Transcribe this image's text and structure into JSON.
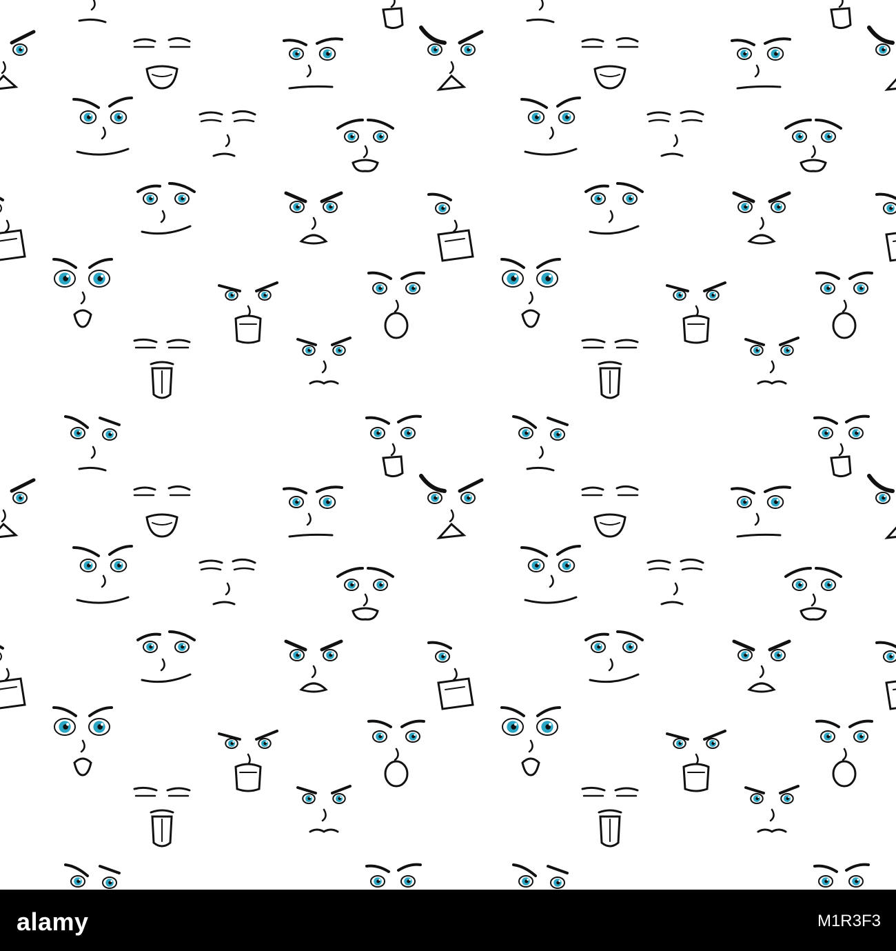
{
  "image": {
    "subject": "seamless-faces-pattern",
    "palette": {
      "background": "#ffffff",
      "ink": "#111111",
      "iris": "#2aa5c4",
      "footer": "#000000",
      "footer_text": "#ffffff"
    },
    "faces": [
      {
        "id": "worried",
        "expression": "worried"
      },
      {
        "id": "wink-smile",
        "expression": "wink-smile"
      },
      {
        "id": "side-eye",
        "expression": "side-eye"
      },
      {
        "id": "grimace",
        "expression": "grimace"
      },
      {
        "id": "sly",
        "expression": "sly"
      },
      {
        "id": "angry-frown",
        "expression": "angry-frown"
      },
      {
        "id": "squint-smirk",
        "expression": "squint-smirk"
      },
      {
        "id": "furious",
        "expression": "furious"
      },
      {
        "id": "shouting",
        "expression": "shouting"
      },
      {
        "id": "shocked",
        "expression": "shocked"
      },
      {
        "id": "yelling",
        "expression": "yelling"
      },
      {
        "id": "scared",
        "expression": "scared"
      },
      {
        "id": "tongue-out",
        "expression": "tongue-out"
      },
      {
        "id": "pouting",
        "expression": "pouting"
      },
      {
        "id": "suspicious",
        "expression": "suspicious"
      },
      {
        "id": "cheeky",
        "expression": "cheeky"
      }
    ]
  },
  "footer": {
    "brand": "alamy",
    "image_code": "M1R3F3"
  }
}
